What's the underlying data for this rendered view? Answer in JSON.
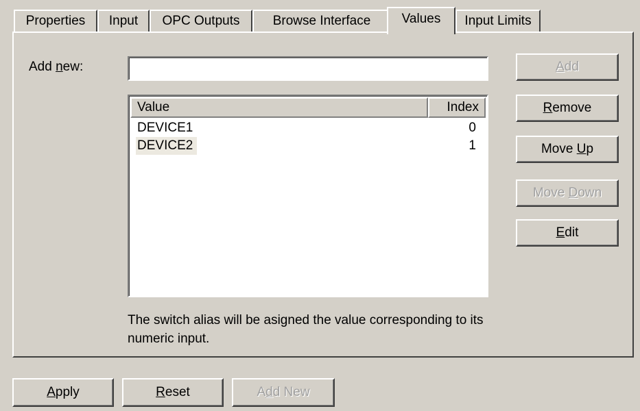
{
  "tabs": [
    {
      "label": "Properties"
    },
    {
      "label": "Input"
    },
    {
      "label": "OPC Outputs"
    },
    {
      "label": "Browse Interface"
    },
    {
      "label": "Values",
      "active": true
    },
    {
      "label": "Input Limits"
    }
  ],
  "add_new": {
    "label_pre": "Add ",
    "label_ul": "n",
    "label_post": "ew:",
    "value": ""
  },
  "list": {
    "columns": {
      "value": "Value",
      "index": "Index"
    },
    "rows": [
      {
        "value": "DEVICE1",
        "index": "0",
        "selected": false
      },
      {
        "value": "DEVICE2",
        "index": "1",
        "selected": true
      }
    ]
  },
  "note": "The switch alias will be asigned the value corresponding to its numeric input.",
  "side_buttons": {
    "add": {
      "pre": "",
      "ul": "A",
      "post": "dd",
      "enabled": false
    },
    "remove": {
      "pre": "",
      "ul": "R",
      "post": "emove",
      "enabled": true
    },
    "move_up": {
      "pre": "Move ",
      "ul": "U",
      "post": "p",
      "enabled": true
    },
    "move_down": {
      "pre": "Move ",
      "ul": "D",
      "post": "own",
      "enabled": false
    },
    "edit": {
      "pre": "",
      "ul": "E",
      "post": "dit",
      "enabled": true
    }
  },
  "bottom_buttons": {
    "apply": {
      "pre": "",
      "ul": "A",
      "post": "pply",
      "enabled": true
    },
    "reset": {
      "pre": "",
      "ul": "R",
      "post": "eset",
      "enabled": true
    },
    "add_new": {
      "pre": "A",
      "ul": "d",
      "post": "d New",
      "enabled": false
    }
  }
}
